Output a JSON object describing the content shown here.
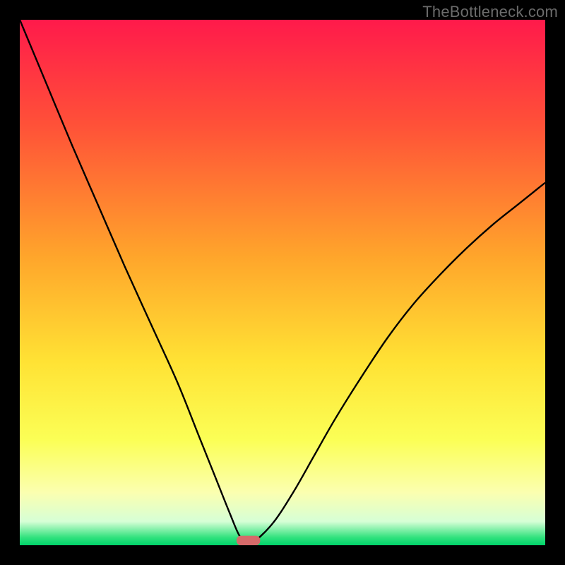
{
  "watermark": "TheBottleneck.com",
  "chart_data": {
    "type": "line",
    "title": "",
    "xlabel": "",
    "ylabel": "",
    "xlim": [
      0,
      100
    ],
    "ylim": [
      0,
      100
    ],
    "background_gradient": {
      "stops": [
        {
          "offset": 0.0,
          "color": "#ff1a4b"
        },
        {
          "offset": 0.2,
          "color": "#ff5138"
        },
        {
          "offset": 0.45,
          "color": "#ffa52b"
        },
        {
          "offset": 0.65,
          "color": "#ffe234"
        },
        {
          "offset": 0.8,
          "color": "#fbff56"
        },
        {
          "offset": 0.9,
          "color": "#fbffb0"
        },
        {
          "offset": 0.955,
          "color": "#d6ffd6"
        },
        {
          "offset": 0.985,
          "color": "#32e27e"
        },
        {
          "offset": 1.0,
          "color": "#00d36a"
        }
      ]
    },
    "series": [
      {
        "name": "bottleneck-curve",
        "x": [
          0,
          5,
          10,
          15,
          20,
          25,
          30,
          34,
          37,
          40,
          42,
          44,
          48,
          52,
          56,
          60,
          65,
          70,
          75,
          80,
          85,
          90,
          95,
          100
        ],
        "y": [
          100,
          88,
          76,
          64.5,
          53,
          42,
          31,
          21,
          13.5,
          6,
          1.5,
          0.4,
          4,
          10,
          17,
          24,
          32,
          39.5,
          46,
          51.5,
          56.5,
          61,
          65,
          69
        ]
      }
    ],
    "marker": {
      "name": "optimal-marker",
      "x": 43.5,
      "y": 0,
      "width": 4.5,
      "height": 1.8,
      "color": "#d66a6a"
    }
  }
}
